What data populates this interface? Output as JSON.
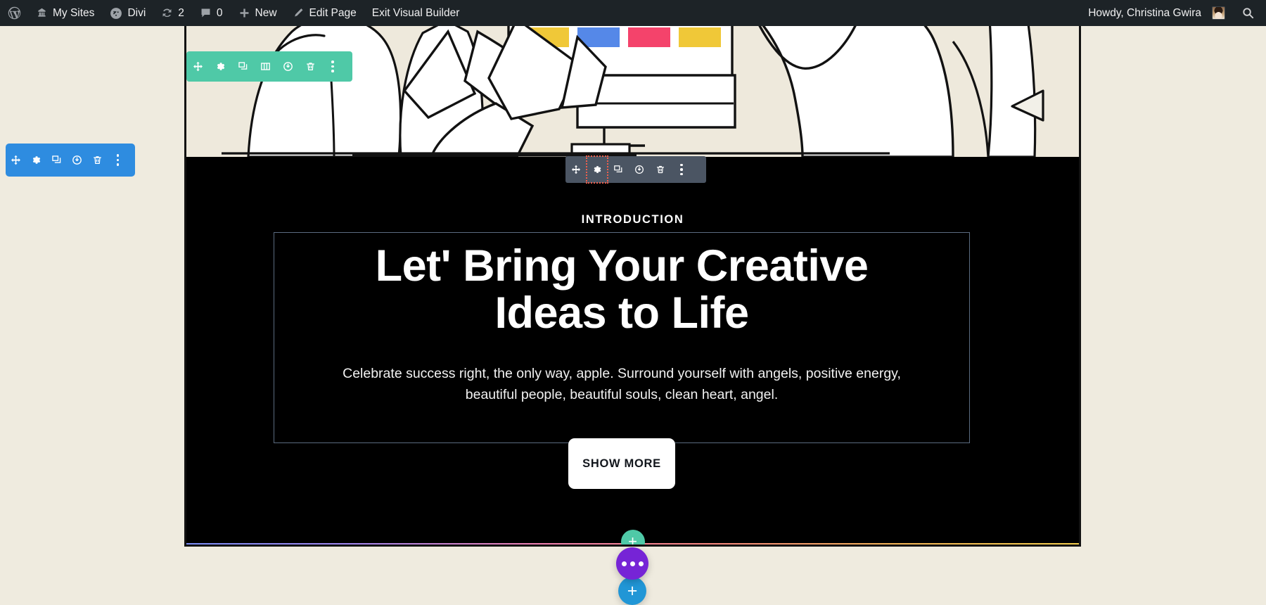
{
  "adminbar": {
    "items": [
      {
        "id": "wp-logo",
        "icon": "wordpress-icon",
        "label": ""
      },
      {
        "id": "my-sites",
        "icon": "sites-icon",
        "label": "My Sites"
      },
      {
        "id": "divi",
        "icon": "divi-icon",
        "label": "Divi"
      },
      {
        "id": "updates",
        "icon": "updates-icon",
        "label": "2"
      },
      {
        "id": "comments",
        "icon": "comment-icon",
        "label": "0"
      },
      {
        "id": "new-content",
        "icon": "plus-icon",
        "label": "New"
      },
      {
        "id": "edit-page",
        "icon": "pencil-icon",
        "label": "Edit Page"
      },
      {
        "id": "exit-builder",
        "icon": "",
        "label": "Exit Visual Builder"
      }
    ],
    "howdy": "Howdy, Christina Gwira",
    "search_icon": "search-icon"
  },
  "hero": {
    "swatch_colors": [
      "#f0c838",
      "#5588e8",
      "#f4436b",
      "#f0c838"
    ],
    "background": "#eee9dc"
  },
  "intro": {
    "eyebrow": "INTRODUCTION",
    "headline_line1": "Let' Bring Your Creative",
    "headline_line2": "Ideas to Life",
    "body": "Celebrate success right, the only way, apple. Surround yourself with angels, positive energy, beautiful people, beautiful souls, clean heart, angel.",
    "button_label": "SHOW MORE",
    "background": "#000000",
    "module_outline": "#5b6b80"
  },
  "gradient_bar": {
    "stops": [
      "#7a8cf5",
      "#9f85ee",
      "#f07fae",
      "#f6847f",
      "#f2b455",
      "#f2cc4c"
    ]
  },
  "toolbars": {
    "section": {
      "color": "#2e8ce0",
      "buttons": [
        "move-icon",
        "gear-icon",
        "duplicate-icon",
        "disable-icon",
        "trash-icon",
        "more-dots-icon"
      ]
    },
    "row": {
      "color": "#4fc9a7",
      "buttons": [
        "move-icon",
        "gear-icon",
        "duplicate-icon",
        "columns-icon",
        "disable-icon",
        "trash-icon",
        "more-dots-icon"
      ]
    },
    "module": {
      "color": "#4b5563",
      "selected": "gear-icon",
      "buttons": [
        "move-icon",
        "gear-icon",
        "duplicate-icon",
        "disable-icon",
        "trash-icon",
        "more-dots-icon"
      ]
    }
  },
  "floating": {
    "section_add": "+",
    "button_add_overlay": "+",
    "page_more": "more-dots-icon",
    "page_add": "+"
  }
}
